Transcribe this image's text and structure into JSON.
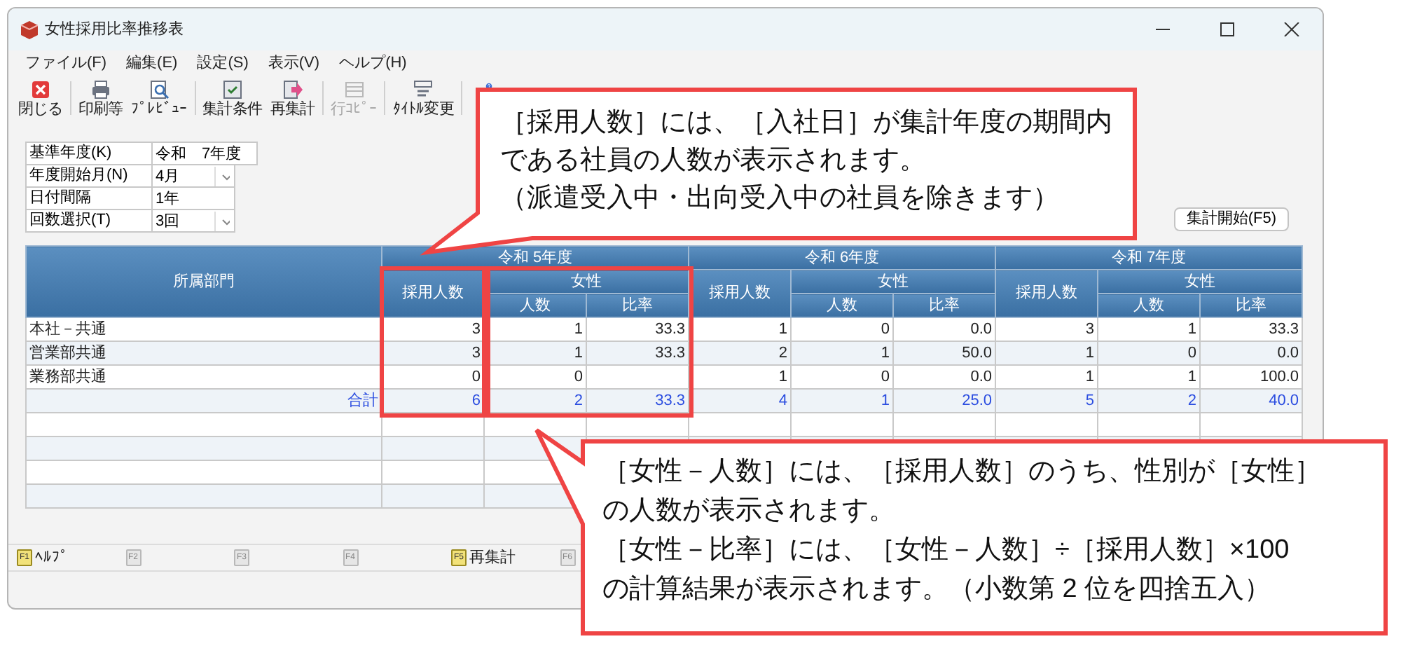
{
  "window": {
    "title": "女性採用比率推移表"
  },
  "menu": [
    "ファイル(F)",
    "編集(E)",
    "設定(S)",
    "表示(V)",
    "ヘルプ(H)"
  ],
  "toolbar": [
    [
      {
        "kind": "close",
        "label": "閉じる",
        "disabled": false
      }
    ],
    [
      {
        "kind": "print",
        "label": "印刷等",
        "disabled": false
      },
      {
        "kind": "preview",
        "label": "ﾌﾟﾚﾋﾞｭｰ",
        "disabled": false
      }
    ],
    [
      {
        "kind": "conditions",
        "label": "集計条件",
        "disabled": false
      },
      {
        "kind": "recalc",
        "label": "再集計",
        "disabled": false
      }
    ],
    [
      {
        "kind": "copy",
        "label": "行ｺﾋﾟｰ",
        "disabled": true
      }
    ],
    [
      {
        "kind": "title",
        "label": "ﾀｲﾄﾙ変更",
        "disabled": false
      }
    ],
    [
      {
        "kind": "help"
      }
    ]
  ],
  "settings": [
    {
      "label": "基準年度(K)",
      "value": "令和　7年度",
      "dropdown": false
    },
    {
      "label": "年度開始月(N)",
      "value": "4月",
      "dropdown": true
    },
    {
      "label": "日付間隔",
      "value": "1年",
      "dropdown": false
    },
    {
      "label": "回数選択(T)",
      "value": "3回",
      "dropdown": true
    }
  ],
  "start_button": "集計開始(F5)",
  "table": {
    "dept_header": "所属部門",
    "years": [
      {
        "label": "令和 5年度",
        "hires_header": "採用人数",
        "female_header": "女性",
        "count_header": "人数",
        "ratio_header": "比率"
      },
      {
        "label": "令和 6年度",
        "hires_header": "採用人数",
        "female_header": "女性",
        "count_header": "人数",
        "ratio_header": "比率"
      },
      {
        "label": "令和 7年度",
        "hires_header": "採用人数",
        "female_header": "女性",
        "count_header": "人数",
        "ratio_header": "比率"
      }
    ],
    "rows": [
      {
        "kind": "data",
        "dept": "本社－共通",
        "values": [
          {
            "hires": "3",
            "count": "1",
            "ratio": "33.3"
          },
          {
            "hires": "1",
            "count": "0",
            "ratio": "0.0"
          },
          {
            "hires": "3",
            "count": "1",
            "ratio": "33.3"
          }
        ]
      },
      {
        "kind": "data",
        "dept": "営業部共通",
        "values": [
          {
            "hires": "3",
            "count": "1",
            "ratio": "33.3"
          },
          {
            "hires": "2",
            "count": "1",
            "ratio": "50.0"
          },
          {
            "hires": "1",
            "count": "0",
            "ratio": "0.0"
          }
        ]
      },
      {
        "kind": "data",
        "dept": "業務部共通",
        "values": [
          {
            "hires": "0",
            "count": "0"
          },
          {
            "hires": "1",
            "count": "0",
            "ratio": "0.0"
          },
          {
            "hires": "1",
            "count": "1",
            "ratio": "100.0"
          }
        ]
      },
      {
        "kind": "total",
        "dept": "合計",
        "values": [
          {
            "hires": "6",
            "count": "2",
            "ratio": "33.3"
          },
          {
            "hires": "4",
            "count": "1",
            "ratio": "25.0"
          },
          {
            "hires": "5",
            "count": "2",
            "ratio": "40.0"
          }
        ]
      }
    ]
  },
  "function_keys": [
    {
      "key": "F1",
      "label": "ﾍﾙﾌﾟ",
      "enabled": true
    },
    {
      "key": "F2",
      "enabled": false
    },
    {
      "key": "F3",
      "enabled": false
    },
    {
      "key": "F4",
      "enabled": false
    },
    {
      "key": "F5",
      "label": "再集計",
      "enabled": true
    },
    {
      "key": "F6",
      "enabled": false
    }
  ],
  "callouts": [
    {
      "lines": [
        "［採用人数］には、［入社日］が集計年度の期間内",
        "である社員の人数が表示されます。",
        "（派遣受入中・出向受入中の社員を除きます）"
      ]
    },
    {
      "lines": [
        "［女性－人数］には、［採用人数］のうち、性別が［女性］",
        "の人数が表示されます。",
        "［女性－比率］には、［女性－人数］÷［採用人数］×100",
        "の計算結果が表示されます。（小数第 2 位を四捨五入）"
      ]
    }
  ]
}
